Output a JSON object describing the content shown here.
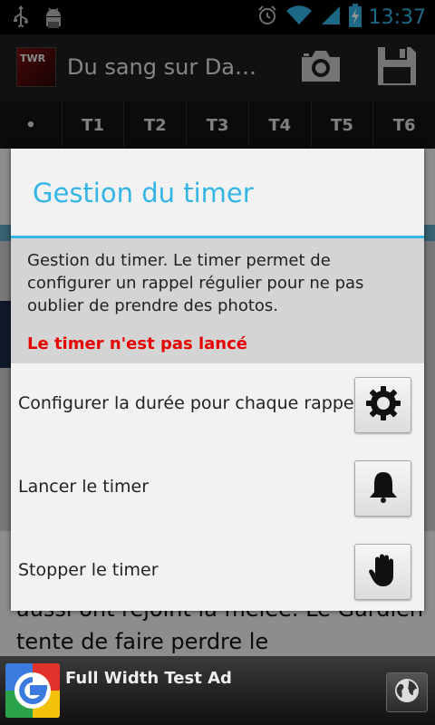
{
  "status_bar": {
    "time": "13:37",
    "icons": [
      "usb-icon",
      "android-debug-icon",
      "alarm-icon",
      "wifi-icon",
      "signal-icon",
      "battery-charging-icon"
    ]
  },
  "action_bar": {
    "app_icon_text": "TWR",
    "title": "Du sang sur Da…",
    "camera_icon": "camera-icon",
    "save_icon": "save-icon"
  },
  "tabs": [
    "•",
    "T1",
    "T2",
    "T3",
    "T4",
    "T5",
    "T6"
  ],
  "background": {
    "text": "aussi ont rejoint la mêlée. Le Gardien tente de faire perdre le"
  },
  "dialog": {
    "title": "Gestion du timer",
    "description": "Gestion du timer. Le timer permet de configurer un rappel régulier pour ne pas oublier de prendre des photos.",
    "status": "Le timer n'est pas lancé",
    "rows": [
      {
        "label": "Configurer la durée pour chaque rappel",
        "icon": "gear-icon"
      },
      {
        "label": "Lancer le timer",
        "icon": "bell-icon"
      },
      {
        "label": "Stopper le timer",
        "icon": "hand-stop-icon"
      }
    ]
  },
  "ad": {
    "text": "Full Width Test Ad",
    "icon": "globe-icon"
  },
  "colors": {
    "accent": "#33b5e5",
    "status_red": "#e60000"
  }
}
